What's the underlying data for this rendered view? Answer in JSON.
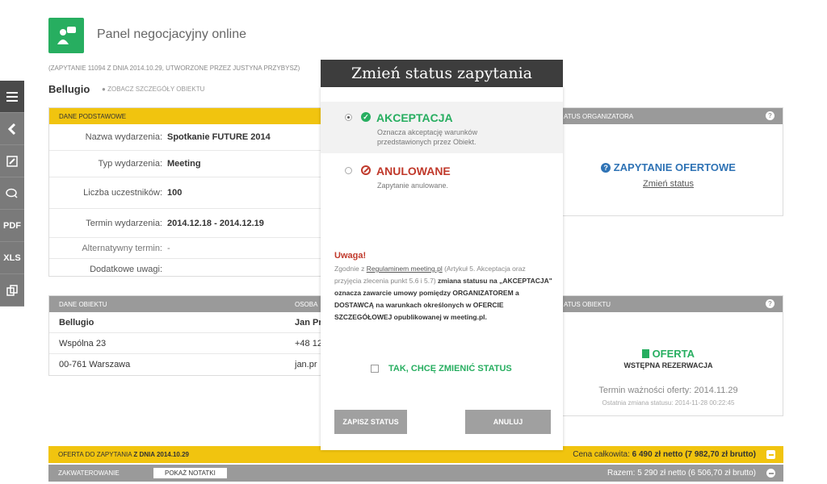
{
  "colors": {
    "accent": "#27ae60",
    "yellow": "#f1c40f",
    "danger": "#c0392b",
    "link": "#2f73b5",
    "toolbar": "#7a7a7a"
  },
  "header": {
    "title": "Panel negocjacyjny online",
    "meta": "(ZAPYTANIE 11094 Z DNIA 2014.10.29, UTWORZONE PRZEZ JUSTYNA PRZYBYSZ)",
    "hotel": "Bellugio",
    "hotel_link": "ZOBACZ SZCZEGÓŁY OBIEKTU"
  },
  "sidebar": {
    "items": [
      {
        "icon": "menu-icon"
      },
      {
        "icon": "chevron-left-icon"
      },
      {
        "icon": "pencil-icon"
      },
      {
        "icon": "chat-icon"
      },
      {
        "label": "PDF"
      },
      {
        "label": "XLS"
      },
      {
        "icon": "copy-icon"
      }
    ]
  },
  "basic": {
    "header": "DANE PODSTAWOWE",
    "rows": [
      {
        "label": "Nazwa wydarzenia:",
        "value": "Spotkanie FUTURE 2014"
      },
      {
        "label": "Typ wydarzenia:",
        "value": "Meeting"
      },
      {
        "label": "Liczba uczestników:",
        "value": "100"
      },
      {
        "label": "Termin wydarzenia:",
        "value": "2014.12.18 - 2014.12.19"
      },
      {
        "label": "Alternatywny termin:",
        "value": "-"
      },
      {
        "label": "Dodatkowe uwagi:",
        "value": ""
      }
    ]
  },
  "object": {
    "header": "DANE OBIEKTU",
    "contact_header": "OSOBA",
    "rows": [
      {
        "left": "Bellugio",
        "right": "Jan Pr"
      },
      {
        "left": "Wspólna 23",
        "right": "+48 12"
      },
      {
        "left": "00-761 Warszawa",
        "right": "jan.pr"
      }
    ]
  },
  "org_status": {
    "header": "ATUS ORGANIZATORA",
    "status": "ZAPYTANIE OFERTOWE",
    "link": "Zmień status"
  },
  "obj_status": {
    "header": "ATUS OBIEKTU",
    "status": "OFERTA",
    "substatus": "WSTĘPNA REZERWACJA",
    "validity": "Termin ważności oferty: 2014.11.29",
    "last_change": "Ostatnia zmiana statusu: 2014-11-28 00:22:45"
  },
  "modal": {
    "title": "Zmień status zapytania",
    "option_accept": {
      "label": "AKCEPTACJA",
      "desc1": "Oznacza akceptację warunków",
      "desc2": "przedstawionych przez Obiekt."
    },
    "option_cancel": {
      "label": "ANULOWANE",
      "desc": "Zapytanie anulowane."
    },
    "warning_title": "Uwaga!",
    "warning_1": "Zgodnie z ",
    "warning_link": "Regulaminem meeting.pl",
    "warning_2": " (Artykuł 5. Akceptacja oraz przyjęcia zlecenia punkt 5.6 i 5.7) ",
    "warning_bold": "zmiana statusu na „AKCEPTACJA\" oznacza zawarcie umowy pomiędzy ORGANIZATOREM a DOSTAWCĄ na warunkach określonych w OFERCIE SZCZEGÓŁOWEJ opublikowanej w meeting.pl.",
    "checkbox_label": "TAK, CHCĘ ZMIENIĆ STATUS",
    "save_label": "ZAPISZ STATUS",
    "cancel_label": "ANULUJ"
  },
  "offer": {
    "left_prefix": "OFERTA DO ZAPYTANIA ",
    "left_bold": "Z DNIA 2014.10.29",
    "total_prefix": "Cena całkowita: ",
    "total_value": "6 490 zł netto (7 982,70 zł brutto)"
  },
  "accommodation": {
    "label": "ZAKWATEROWANIE",
    "notes_button": "POKAŻ NOTATKI",
    "sum": "Razem: 5 290 zł netto (6 506,70 zł brutto)"
  }
}
